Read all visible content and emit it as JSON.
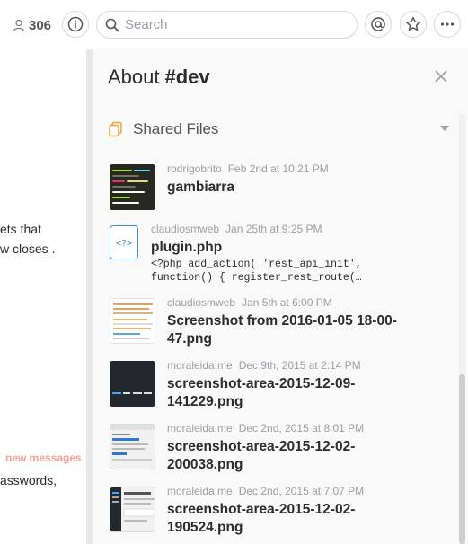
{
  "header": {
    "member_count": "306",
    "search_placeholder": "Search"
  },
  "messages": {
    "line1": "ets that",
    "line2": "w closes .",
    "new_messages": "new messages",
    "line3": "asswords,"
  },
  "flexpane": {
    "title_prefix": "About",
    "channel": "#dev",
    "section_label": "Shared Files",
    "files": [
      {
        "user": "rodrigobrito",
        "time": "Feb 2nd at 10:21 PM",
        "name": "gambiarra",
        "snippet": ""
      },
      {
        "user": "claudiosmweb",
        "time": "Jan 25th at 9:25 PM",
        "name": "plugin.php",
        "snippet": "<?php add_action( 'rest_api_init',\nfunction() { register_rest_route(…"
      },
      {
        "user": "claudiosmweb",
        "time": "Jan 5th at 6:00 PM",
        "name": "Screenshot from 2016-01-05 18-00-47.png",
        "snippet": ""
      },
      {
        "user": "moraleida.me",
        "time": "Dec 9th, 2015 at 2:14 PM",
        "name": "screenshot-area-2015-12-09-141229.png",
        "snippet": ""
      },
      {
        "user": "moraleida.me",
        "time": "Dec 2nd, 2015 at 8:01 PM",
        "name": "screenshot-area-2015-12-02-200038.png",
        "snippet": ""
      },
      {
        "user": "moraleida.me",
        "time": "Dec 2nd, 2015 at 7:07 PM",
        "name": "screenshot-area-2015-12-02-190524.png",
        "snippet": ""
      }
    ]
  },
  "icons": {
    "members": "person-icon",
    "info": "info-icon",
    "search": "search-icon",
    "mentions": "at-sign-icon",
    "star": "star-icon",
    "more": "more-icon",
    "close": "close-icon",
    "shared_files": "files-icon"
  },
  "colors": {
    "accent_orange": "#e8a541",
    "new_messages": "#f7a196",
    "php_icon_blue": "#3b8fd0"
  }
}
